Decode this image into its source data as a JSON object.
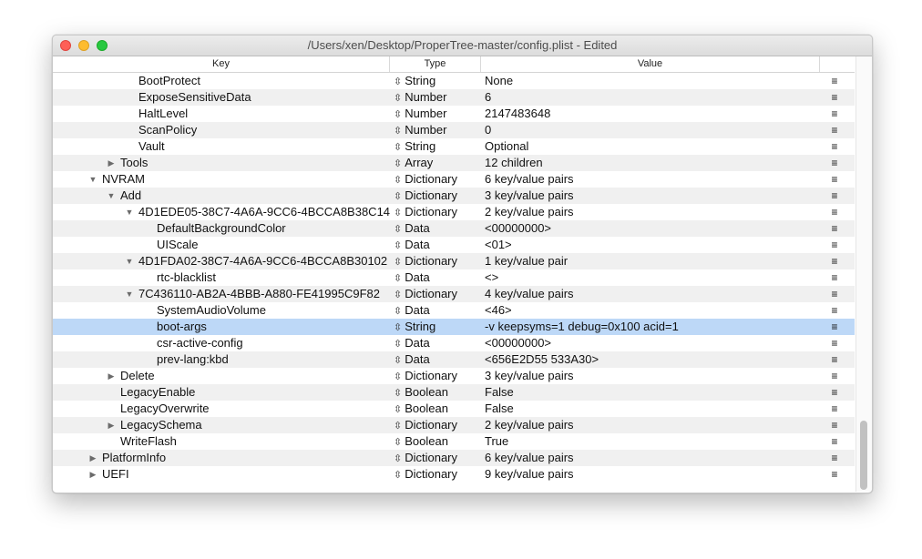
{
  "window": {
    "title": "/Users/xen/Desktop/ProperTree-master/config.plist - Edited"
  },
  "columns": {
    "key": "Key",
    "type": "Type",
    "value": "Value"
  },
  "icons": {
    "updown": "⇳",
    "menu": "≡",
    "disclosure_open": "▼",
    "disclosure_closed": "▶"
  },
  "rows": [
    {
      "key": "BootProtect",
      "type": "String",
      "value": "None",
      "indent": 2,
      "disc": ""
    },
    {
      "key": "ExposeSensitiveData",
      "type": "Number",
      "value": "6",
      "indent": 2,
      "disc": ""
    },
    {
      "key": "HaltLevel",
      "type": "Number",
      "value": "2147483648",
      "indent": 2,
      "disc": ""
    },
    {
      "key": "ScanPolicy",
      "type": "Number",
      "value": "0",
      "indent": 2,
      "disc": ""
    },
    {
      "key": "Vault",
      "type": "String",
      "value": "Optional",
      "indent": 2,
      "disc": ""
    },
    {
      "key": "Tools",
      "type": "Array",
      "value": "12 children",
      "indent": 1,
      "disc": "closed"
    },
    {
      "key": "NVRAM",
      "type": "Dictionary",
      "value": "6 key/value pairs",
      "indent": 0,
      "disc": "open"
    },
    {
      "key": "Add",
      "type": "Dictionary",
      "value": "3 key/value pairs",
      "indent": 1,
      "disc": "open"
    },
    {
      "key": "4D1EDE05-38C7-4A6A-9CC6-4BCCA8B38C14",
      "type": "Dictionary",
      "value": "2 key/value pairs",
      "indent": 2,
      "disc": "open"
    },
    {
      "key": "DefaultBackgroundColor",
      "type": "Data",
      "value": "<00000000>",
      "indent": 3,
      "disc": ""
    },
    {
      "key": "UIScale",
      "type": "Data",
      "value": "<01>",
      "indent": 3,
      "disc": ""
    },
    {
      "key": "4D1FDA02-38C7-4A6A-9CC6-4BCCA8B30102",
      "type": "Dictionary",
      "value": "1 key/value pair",
      "indent": 2,
      "disc": "open"
    },
    {
      "key": "rtc-blacklist",
      "type": "Data",
      "value": "<>",
      "indent": 3,
      "disc": ""
    },
    {
      "key": "7C436110-AB2A-4BBB-A880-FE41995C9F82",
      "type": "Dictionary",
      "value": "4 key/value pairs",
      "indent": 2,
      "disc": "open"
    },
    {
      "key": "SystemAudioVolume",
      "type": "Data",
      "value": "<46>",
      "indent": 3,
      "disc": ""
    },
    {
      "key": "boot-args",
      "type": "String",
      "value": "-v keepsyms=1 debug=0x100 acid=1",
      "indent": 3,
      "disc": "",
      "selected": true
    },
    {
      "key": "csr-active-config",
      "type": "Data",
      "value": "<00000000>",
      "indent": 3,
      "disc": ""
    },
    {
      "key": "prev-lang:kbd",
      "type": "Data",
      "value": "<656E2D55 533A30>",
      "indent": 3,
      "disc": ""
    },
    {
      "key": "Delete",
      "type": "Dictionary",
      "value": "3 key/value pairs",
      "indent": 1,
      "disc": "closed"
    },
    {
      "key": "LegacyEnable",
      "type": "Boolean",
      "value": "False",
      "indent": 1,
      "disc": ""
    },
    {
      "key": "LegacyOverwrite",
      "type": "Boolean",
      "value": "False",
      "indent": 1,
      "disc": ""
    },
    {
      "key": "LegacySchema",
      "type": "Dictionary",
      "value": "2 key/value pairs",
      "indent": 1,
      "disc": "closed"
    },
    {
      "key": "WriteFlash",
      "type": "Boolean",
      "value": "True",
      "indent": 1,
      "disc": ""
    },
    {
      "key": "PlatformInfo",
      "type": "Dictionary",
      "value": "6 key/value pairs",
      "indent": 0,
      "disc": "closed"
    },
    {
      "key": "UEFI",
      "type": "Dictionary",
      "value": "9 key/value pairs",
      "indent": 0,
      "disc": "closed"
    }
  ]
}
